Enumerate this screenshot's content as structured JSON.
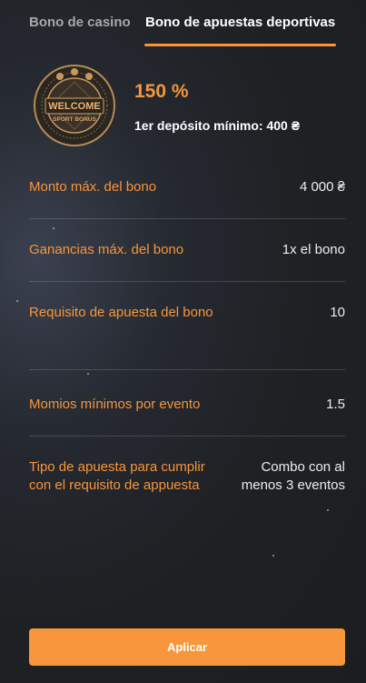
{
  "tabs": [
    {
      "label": "Bono de casino",
      "active": false
    },
    {
      "label": "Bono de apuestas deportivas",
      "active": true
    }
  ],
  "bonus": {
    "badge_line1": "WELCOME",
    "badge_line2": "SPORT BONUS",
    "percent": "150 %",
    "min_deposit": "1er depósito mínimo: 400 ₴"
  },
  "details": [
    {
      "label": "Monto máx. del bono",
      "value": "4 000 ₴"
    },
    {
      "label": "Ganancias máx. del bono",
      "value": "1x el bono"
    },
    {
      "label": "Requisito de apuesta del bono",
      "value": "10"
    },
    {
      "label": "Momios mínimos por evento",
      "value": "1.5"
    },
    {
      "label_line1": "Tipo de apuesta para cumplir",
      "label_line2": "con el requisito de appuesta",
      "value_line1": "Combo con al",
      "value_line2": "menos 3 eventos"
    }
  ],
  "apply_label": "Aplicar",
  "colors": {
    "accent": "#f7963a",
    "background": "#1f2125"
  }
}
